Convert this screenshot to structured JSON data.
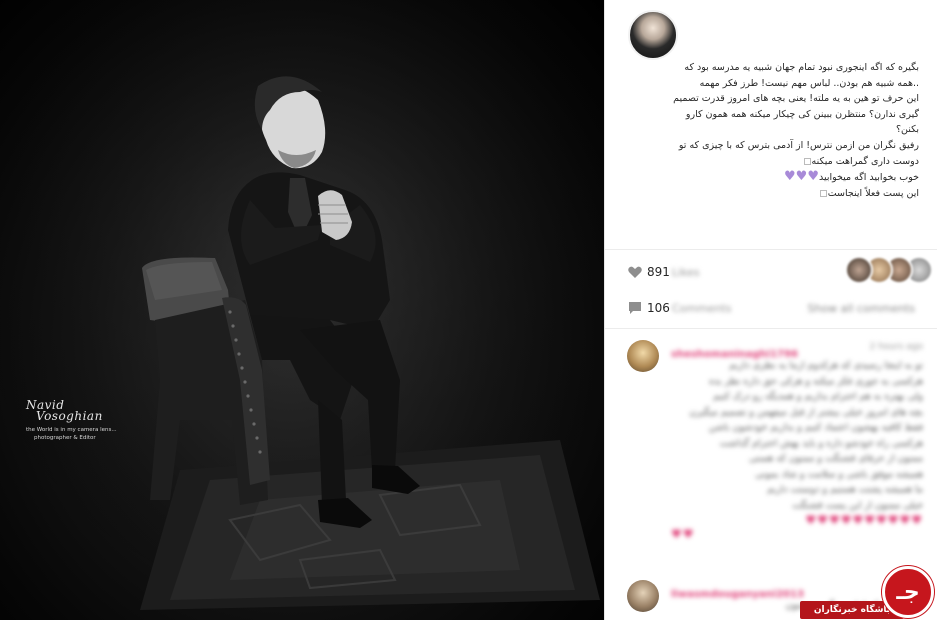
{
  "photo": {
    "watermark": {
      "sig_line1": "Navid",
      "sig_line2": "Vosoghian",
      "tagline": "the World is in my camera lens...",
      "role": "photographer & Editor"
    }
  },
  "post": {
    "caption_lines": [
      "بگیره که اگه اینجوری نبود تمام جهان شبیه یه مدرسه بود که",
      "..همه شبیه هم بودن.. لباس مهم نیست! طرز فکر مهمه",
      "این حرف تو هین به یه ملته! یعنی بچه های امروز قدرت تصمیم",
      "گیری ندارن؟ منتظرن ببینن کی چیکار میکنه همه همون کارو",
      "بکنن؟",
      "رفیق نگران من ازمن نترس! از آدمی بترس که با چیزی که تو",
      "دوست داری گمراهت میکنه",
      "خوب بخوابید اگه میخوابید",
      "این پست فعلاً اینجاست"
    ],
    "hearts_line": "♥♥♥",
    "likes_count": "891",
    "likes_suffix": "Likes",
    "comments_count": "106",
    "comments_suffix": "Comments",
    "see_all": "Show all comments"
  },
  "comments": [
    {
      "username": "sheshomaninaghi1796",
      "time": "2 hours ago",
      "body_lines": [
        "تو به اینجا رسیدی که هرکدوم ازما یه نظری داریم",
        "هرکسی یه جوری فکر میکنه و هرکی حق داره نظر بده",
        "ولی بهتره به هم احترام بذاریم و همدیگه رو درک کنیم",
        "بچه های امروز خیلی بیشتر از قبل میفهمن و تصمیم میگیرن",
        "فقط کافیه بهشون اعتماد کنیم و بذاریم خودشون باشن",
        "هرکسی راه خودشو داره و باید بهش احترام گذاشت",
        "ممنون از حرفای قشنگت و ممنون که هستی",
        "همیشه موفق باشی و سلامت و شاد بمونی",
        "ما همیشه پشتت هستیم و دوستت داریم",
        "خیلی ممنون از این پست قشنگت"
      ],
      "hearts": "♥♥♥♥♥♥♥♥♥♥",
      "hearts2": "♥♥"
    },
    {
      "username": "liwasmdouganyani2013",
      "time": "",
      "body_lines": [
        "خیلی خوبه که اینارو میگی و ممنون"
      ]
    }
  ],
  "badge": {
    "label": "باشگاه خبرنگاران",
    "logo_glyph": "جـ"
  }
}
